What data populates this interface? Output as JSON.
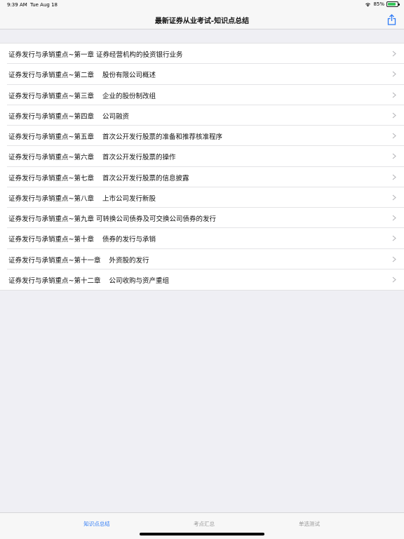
{
  "status_bar": {
    "time": "9:39 AM",
    "date": "Tue Aug 18",
    "battery": "85%",
    "wifi_icon": "wifi-icon",
    "battery_icon": "battery-icon"
  },
  "nav": {
    "title": "最新证券从业考试-知识点总结",
    "share_icon": "share-icon",
    "accent": "#2f7bf6"
  },
  "items": [
    {
      "label": "证券发行与承销重点~第一章 证券经营机构的投资银行业务"
    },
    {
      "label": "证券发行与承销重点~第二章    股份有限公司概述"
    },
    {
      "label": "证券发行与承销重点~第三章    企业的股份制改组"
    },
    {
      "label": "证券发行与承销重点~第四章    公司融资"
    },
    {
      "label": "证券发行与承销重点~第五章    首次公开发行股票的准备和推荐核准程序"
    },
    {
      "label": "证券发行与承销重点~第六章    首次公开发行股票的操作"
    },
    {
      "label": "证券发行与承销重点~第七章    首次公开发行股票的信息披露"
    },
    {
      "label": "证券发行与承销重点~第八章    上市公司发行新股"
    },
    {
      "label": "证券发行与承销重点~第九章 可转换公司债券及可交换公司债券的发行"
    },
    {
      "label": "证券发行与承销重点~第十章    债券的发行与承销"
    },
    {
      "label": "证券发行与承销重点~第十一章    外资股的发行"
    },
    {
      "label": "证券发行与承销重点~第十二章    公司收购与资产重组"
    }
  ],
  "tabs": [
    {
      "label": "知识点总结",
      "active": true
    },
    {
      "label": "考点汇总",
      "active": false
    },
    {
      "label": "单选测试",
      "active": false
    }
  ]
}
